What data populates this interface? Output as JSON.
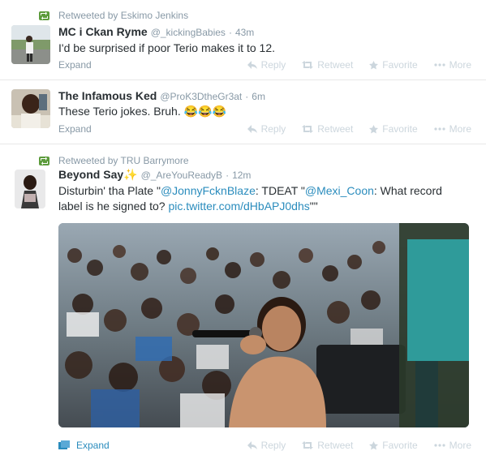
{
  "tweets": [
    {
      "retweeted_by": "Retweeted by Eskimo Jenkins",
      "fullname": "MC i Ckan Ryme",
      "handle": "@_kickingBabies",
      "time": "43m",
      "text": "I'd be surprised if poor Terio makes it to 12.",
      "expand": "Expand"
    },
    {
      "fullname": "The Infamous Ked",
      "handle": "@ProK3DtheGr3at",
      "time": "6m",
      "text": "These Terio jokes. Bruh. 😂😂😂",
      "expand": "Expand"
    },
    {
      "retweeted_by": "Retweeted by TRU Barrymore",
      "fullname": "Beyond Say✨",
      "handle": "@_AreYouReadyB",
      "time": "12m",
      "text_parts": {
        "p1": "Disturbin' tha Plate \"",
        "link1": "@JonnyFcknBlaze",
        "p2": ": TDEAT \"",
        "link2": "@Mexi_Coon",
        "p3": ": What record label is he signed to? ",
        "link3": "pic.twitter.com/dHbAPJ0dhs",
        "p4": "\"\""
      },
      "expand": "Expand"
    }
  ],
  "actions": {
    "reply": "Reply",
    "retweet": "Retweet",
    "favorite": "Favorite",
    "more": "More"
  },
  "colors": {
    "link": "#2a8cbd",
    "retweet_green": "#5c9b3c",
    "muted": "#8899a6",
    "action": "#ccd6dd"
  }
}
